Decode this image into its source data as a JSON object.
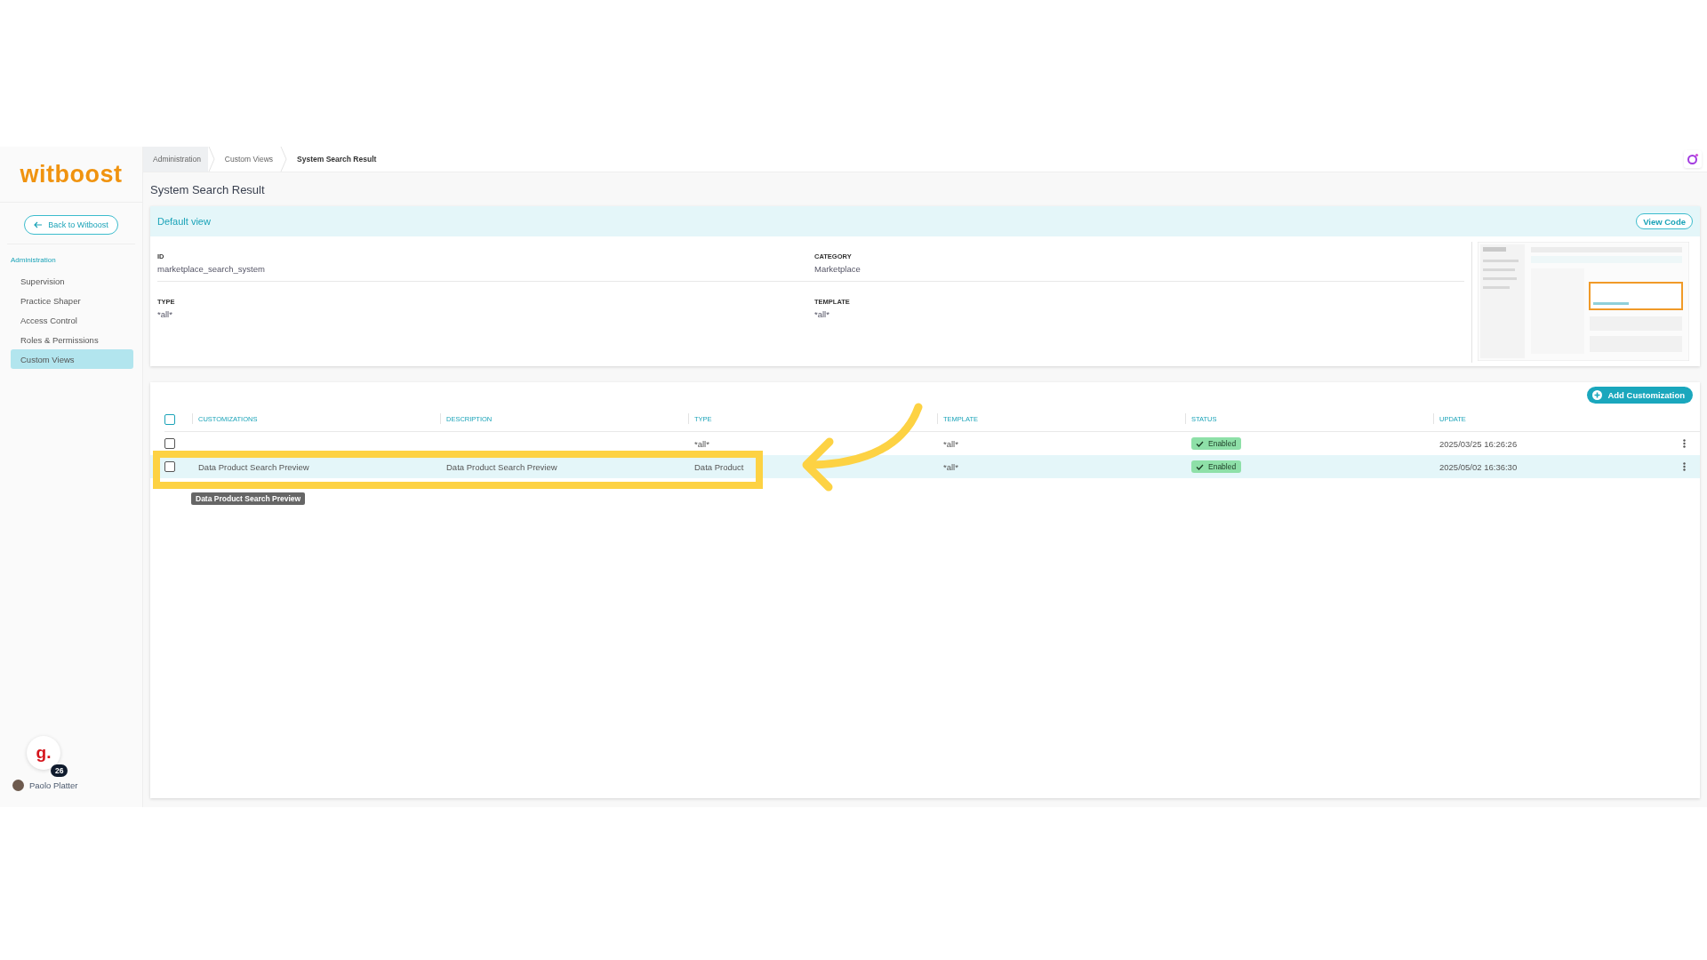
{
  "logo": {
    "text": "witboost"
  },
  "back_button": {
    "label": "Back to Witboost"
  },
  "sidebar": {
    "section": "Administration",
    "items": [
      {
        "label": "Supervision",
        "selected": false
      },
      {
        "label": "Practice Shaper",
        "selected": false
      },
      {
        "label": "Access Control",
        "selected": false
      },
      {
        "label": "Roles & Permissions",
        "selected": false
      },
      {
        "label": "Custom Views",
        "selected": true
      }
    ]
  },
  "assistant_badge": {
    "glyph": "g.",
    "count": "26"
  },
  "user": {
    "name": "Paolo Platter"
  },
  "breadcrumbs": [
    {
      "label": "Administration"
    },
    {
      "label": "Custom Views"
    },
    {
      "label": "System Search Result"
    }
  ],
  "page_title": "System Search Result",
  "view_card": {
    "title": "Default view",
    "button": "View Code",
    "fields": [
      {
        "label": "ID",
        "value": "marketplace_search_system"
      },
      {
        "label": "CATEGORY",
        "value": "Marketplace"
      },
      {
        "label": "TYPE",
        "value": "*all*"
      },
      {
        "label": "TEMPLATE",
        "value": "*all*"
      }
    ]
  },
  "table": {
    "add_button": "Add Customization",
    "all_checked": false,
    "columns": [
      "CUSTOMIZATIONS",
      "DESCRIPTION",
      "TYPE",
      "TEMPLATE",
      "STATUS",
      "UPDATE"
    ],
    "rows": [
      {
        "checked": false,
        "selected": false,
        "type": "*all*",
        "template": "*all*",
        "status": "Enabled",
        "update": "2025/03/25 16:26:26"
      },
      {
        "checked": false,
        "selected": true,
        "customization": "Data Product Search Preview",
        "description": "Data Product Search Preview",
        "type": "Data Product",
        "template": "*all*",
        "status": "Enabled",
        "update": "2025/05/02 16:36:30"
      }
    ]
  },
  "tooltip": "Data Product Search Preview"
}
